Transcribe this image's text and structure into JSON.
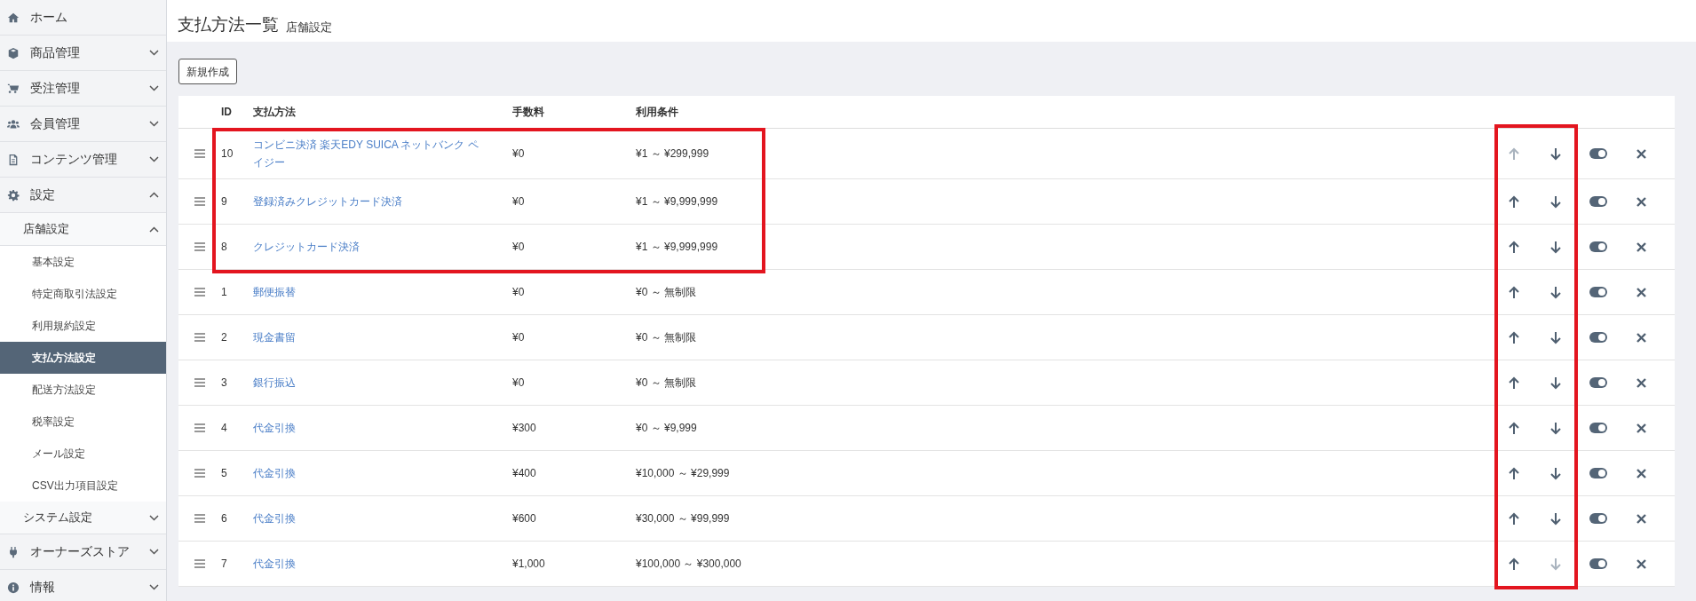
{
  "sidebar": {
    "items": [
      {
        "label": "ホーム"
      },
      {
        "label": "商品管理",
        "expanded": false
      },
      {
        "label": "受注管理",
        "expanded": false
      },
      {
        "label": "会員管理",
        "expanded": false
      },
      {
        "label": "コンテンツ管理",
        "expanded": false
      },
      {
        "label": "設定",
        "expanded": true,
        "children": [
          {
            "label": "店舗設定",
            "expanded": true,
            "children": [
              {
                "label": "基本設定",
                "selected": false
              },
              {
                "label": "特定商取引法設定",
                "selected": false
              },
              {
                "label": "利用規約設定",
                "selected": false
              },
              {
                "label": "支払方法設定",
                "selected": true
              },
              {
                "label": "配送方法設定",
                "selected": false
              },
              {
                "label": "税率設定",
                "selected": false
              },
              {
                "label": "メール設定",
                "selected": false
              },
              {
                "label": "CSV出力項目設定",
                "selected": false
              }
            ]
          },
          {
            "label": "システム設定",
            "expanded": false
          }
        ]
      },
      {
        "label": "オーナーズストア",
        "expanded": false
      },
      {
        "label": "情報",
        "expanded": false
      }
    ]
  },
  "page": {
    "title": "支払方法一覧",
    "subtitle": "店舗設定"
  },
  "new_button": "新規作成",
  "table": {
    "columns": [
      "ID",
      "支払方法",
      "手数料",
      "利用条件"
    ],
    "sort_column_highlighted": true,
    "rows": [
      {
        "id": "10",
        "method": "コンビニ決済 楽天EDY SUICA ネットバンク ペイジー",
        "fee": "¥0",
        "condition": "¥1 ～ ¥299,999",
        "up_disabled": true,
        "down_disabled": false,
        "highlighted": true
      },
      {
        "id": "9",
        "method": "登録済みクレジットカード決済",
        "fee": "¥0",
        "condition": "¥1 ～ ¥9,999,999",
        "up_disabled": false,
        "down_disabled": false,
        "highlighted": true
      },
      {
        "id": "8",
        "method": "クレジットカード決済",
        "fee": "¥0",
        "condition": "¥1 ～ ¥9,999,999",
        "up_disabled": false,
        "down_disabled": false,
        "highlighted": true
      },
      {
        "id": "1",
        "method": "郵便振替",
        "fee": "¥0",
        "condition": "¥0 ～ 無制限",
        "up_disabled": false,
        "down_disabled": false,
        "highlighted": false
      },
      {
        "id": "2",
        "method": "現金書留",
        "fee": "¥0",
        "condition": "¥0 ～ 無制限",
        "up_disabled": false,
        "down_disabled": false,
        "highlighted": false
      },
      {
        "id": "3",
        "method": "銀行振込",
        "fee": "¥0",
        "condition": "¥0 ～ 無制限",
        "up_disabled": false,
        "down_disabled": false,
        "highlighted": false
      },
      {
        "id": "4",
        "method": "代金引換",
        "fee": "¥300",
        "condition": "¥0 ～ ¥9,999",
        "up_disabled": false,
        "down_disabled": false,
        "highlighted": false
      },
      {
        "id": "5",
        "method": "代金引換",
        "fee": "¥400",
        "condition": "¥10,000 ～ ¥29,999",
        "up_disabled": false,
        "down_disabled": false,
        "highlighted": false
      },
      {
        "id": "6",
        "method": "代金引換",
        "fee": "¥600",
        "condition": "¥30,000 ～ ¥99,999",
        "up_disabled": false,
        "down_disabled": false,
        "highlighted": false
      },
      {
        "id": "7",
        "method": "代金引換",
        "fee": "¥1,000",
        "condition": "¥100,000 ～ ¥300,000",
        "up_disabled": false,
        "down_disabled": true,
        "highlighted": false
      }
    ]
  }
}
